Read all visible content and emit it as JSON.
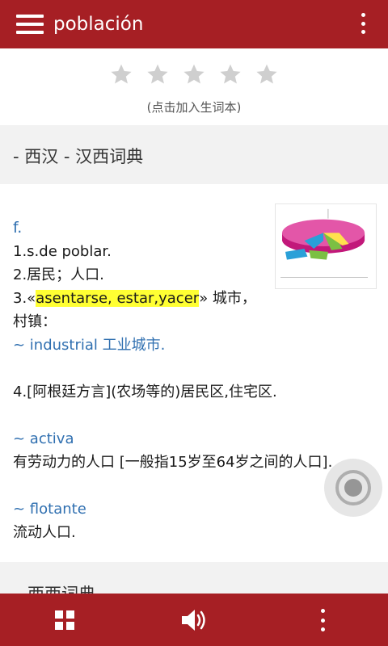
{
  "app_bar": {
    "title": "población",
    "menu_icon": "hamburger-icon",
    "overflow_icon": "more-vert-icon"
  },
  "rating": {
    "stars": 5,
    "filled": 0,
    "hint": "(点击加入生词本)"
  },
  "source_title": "- 西汉 - 汉西词典",
  "entry": {
    "pos": "f.",
    "line1": "1.s.de poblar.",
    "line2": "2.居民；人口.",
    "line3_prefix": "3.«",
    "line3_highlight": "asentarse, estar,yacer",
    "line3_suffix": "» 城市，",
    "line3_cont": "村镇：",
    "example1": "~ industrial 工业城市.",
    "line4": "4.[阿根廷方言](农场等的)居民区,住宅区.",
    "phrase1": "~ activa",
    "phrase1_def": "有劳动力的人口 [一般指15岁至64岁之间的人口].",
    "phrase2": "~ flotante",
    "phrase2_def": "流动人口."
  },
  "next_section": "西西词典",
  "bottom_bar": {
    "left_icon": "grid-icon",
    "center_icon": "speaker-icon",
    "right_icon": "more-vert-icon"
  },
  "colors": {
    "primary": "#a61f24",
    "link": "#2f6fb0",
    "highlight": "#ffff33"
  }
}
